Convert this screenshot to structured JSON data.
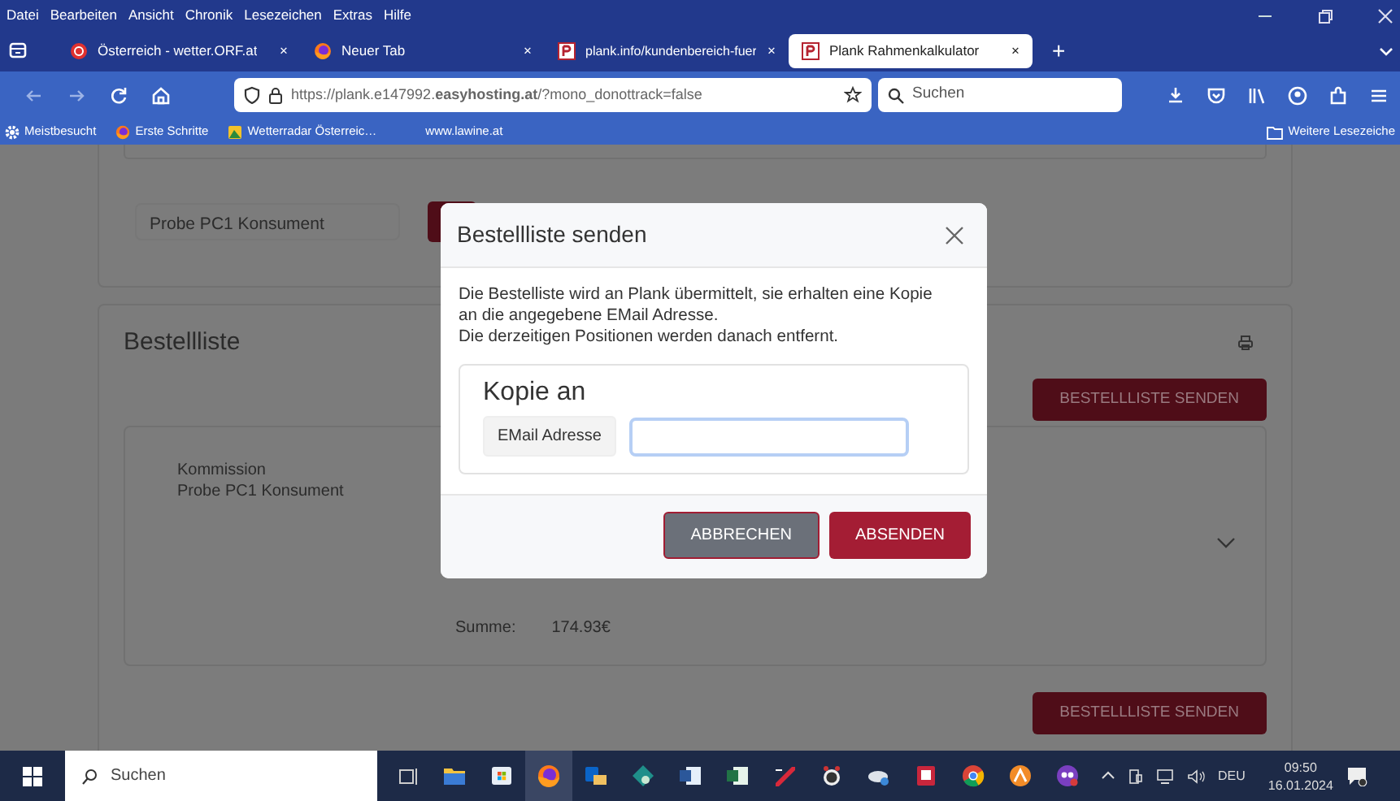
{
  "menu_bar": [
    "Datei",
    "Bearbeiten",
    "Ansicht",
    "Chronik",
    "Lesezeichen",
    "Extras",
    "Hilfe"
  ],
  "tabs": [
    {
      "label": "Österreich - wetter.ORF.at",
      "kind": "orf",
      "selected": false,
      "close": "×"
    },
    {
      "label": "Neuer Tab",
      "kind": "firefox",
      "selected": false,
      "close": "×"
    },
    {
      "label": "plank.info/kundenbereich-fuer",
      "kind": "plank",
      "selected": false,
      "close": "×"
    },
    {
      "label": "Plank Rahmenkalkulator",
      "kind": "plank",
      "selected": true,
      "close": "×"
    }
  ],
  "new_tab": "+",
  "address_bar": {
    "url": "https://plank.e147992.**easyhosting.at**/?mono_donottrack=false"
  },
  "search_field": {
    "placeholder": "Suchen"
  },
  "bookmarks": [
    {
      "label": "Meistbesucht",
      "kind": "gear"
    },
    {
      "label": "Erste Schritte",
      "kind": "firefox"
    },
    {
      "label": "Wetterradar Österreic…",
      "kind": "radar"
    },
    {
      "label": "www.lawine.at",
      "kind": "none"
    }
  ],
  "other_bookmarks": "Weitere Lesezeiche",
  "page": {
    "order_name": "Probe PC1 Konsument",
    "order_list": {
      "title": "Bestellliste",
      "send_button": "BESTELLLISTE SENDEN",
      "commission_label": "Kommission",
      "commission_value": "Probe PC1 Konsument",
      "sum_label": "Summe:",
      "sum_value": "174.93€",
      "send_button_bottom": "BESTELLLISTE SENDEN"
    }
  },
  "modal": {
    "title": "Bestellliste senden",
    "body": [
      "Die Bestelliste wird an Plank übermittelt, sie erhalten eine Kopie",
      "an die angegebene EMail Adresse.",
      "Die derzeitigen Positionen werden danach entfernt."
    ],
    "copy_heading": "Kopie an",
    "email_label": "EMail Adresse",
    "buttons": [
      {
        "label": "ABBRECHEN",
        "kind": "secondary"
      },
      {
        "label": "ABSENDEN",
        "kind": "primary"
      }
    ]
  },
  "taskbar": {
    "search_placeholder": "Suchen",
    "apps": [
      {
        "kind": "taskview",
        "selected": false
      },
      {
        "kind": "folder",
        "selected": false
      },
      {
        "kind": "store",
        "selected": false
      },
      {
        "kind": "firefox",
        "selected": true
      },
      {
        "kind": "outlook",
        "selected": false
      },
      {
        "kind": "diamond",
        "selected": false
      },
      {
        "kind": "word",
        "selected": false
      },
      {
        "kind": "excel",
        "selected": false
      },
      {
        "kind": "slash",
        "selected": false
      },
      {
        "kind": "clock",
        "selected": false
      },
      {
        "kind": "cloud",
        "selected": false
      },
      {
        "kind": "document",
        "selected": false
      },
      {
        "kind": "chrome",
        "selected": false
      },
      {
        "kind": "orange",
        "selected": false
      },
      {
        "kind": "purple",
        "selected": false
      }
    ],
    "language": "DEU",
    "time": "09:50",
    "date": "16.01.2024"
  }
}
